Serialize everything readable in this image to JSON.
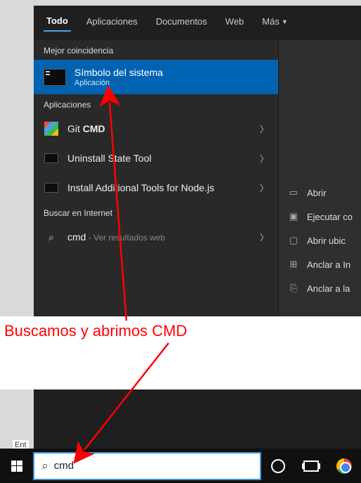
{
  "tabs": {
    "todo": "Todo",
    "apps": "Aplicaciones",
    "docs": "Documentos",
    "web": "Web",
    "more": "Más"
  },
  "sections": {
    "best": "Mejor coincidencia",
    "apps": "Aplicaciones",
    "web": "Buscar en Internet"
  },
  "bestMatch": {
    "title": "Símbolo del sistema",
    "subtitle": "Aplicación"
  },
  "apps": [
    {
      "label_pre": "Git ",
      "label_bold": "CMD"
    },
    {
      "label": "Uninstall State Tool"
    },
    {
      "label": "Install Additional Tools for Node.js"
    }
  ],
  "webSearch": {
    "query": "cmd",
    "suffix": " - Ver resultados web"
  },
  "actions": {
    "open": "Abrir",
    "runas": "Ejecutar co",
    "openloc": "Abrir ubic",
    "pinstart": "Anclar a In",
    "pintask": "Anclar a la"
  },
  "taskbar": {
    "searchValue": "cmd"
  },
  "annotation": {
    "text": "Buscamos y abrimos CMD"
  },
  "misc": {
    "entry": "Ent"
  }
}
